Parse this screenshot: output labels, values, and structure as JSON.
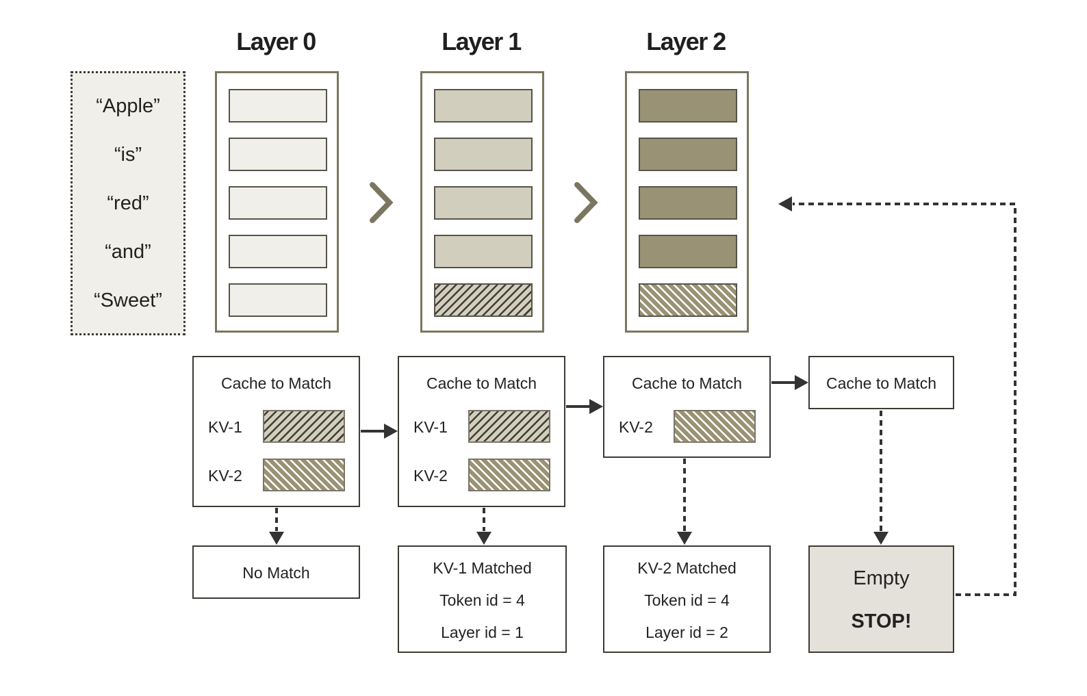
{
  "layers": [
    {
      "title": "Layer 0",
      "slots": [
        "plain",
        "plain",
        "plain",
        "plain",
        "plain"
      ]
    },
    {
      "title": "Layer 1",
      "slots": [
        "filled",
        "filled",
        "filled",
        "filled",
        "kv1-hatched"
      ]
    },
    {
      "title": "Layer 2",
      "slots": [
        "filled",
        "filled",
        "filled",
        "filled",
        "kv2-hatched"
      ]
    }
  ],
  "tokens": [
    "“Apple”",
    "“is”",
    "“red”",
    "“and”",
    "“Sweet”"
  ],
  "cache_boxes": [
    {
      "title": "Cache to Match",
      "entries": [
        {
          "label": "KV-1",
          "pattern": "kv1-hatched"
        },
        {
          "label": "KV-2",
          "pattern": "kv2-hatched"
        }
      ]
    },
    {
      "title": "Cache to Match",
      "entries": [
        {
          "label": "KV-1",
          "pattern": "kv1-hatched"
        },
        {
          "label": "KV-2",
          "pattern": "kv2-hatched"
        }
      ]
    },
    {
      "title": "Cache to Match",
      "entries": [
        {
          "label": "KV-2",
          "pattern": "kv2-hatched"
        }
      ]
    },
    {
      "title": "Cache to Match",
      "entries": []
    }
  ],
  "results": [
    {
      "lines": [
        "No Match"
      ]
    },
    {
      "lines": [
        "KV-1 Matched",
        "Token id = 4",
        "Layer id = 1"
      ]
    },
    {
      "lines": [
        "KV-2 Matched",
        "Token id = 4",
        "Layer id = 2"
      ]
    },
    {
      "lines": [
        "Empty",
        "STOP!"
      ]
    }
  ],
  "icons": {
    "layer_transition": "chevron-right-icon",
    "flow_arrow": "arrow-right-icon",
    "result_arrow": "dashed-arrow-down-icon",
    "loop_back_arrow": "dashed-arrow-left-icon"
  },
  "colors": {
    "layer_border": "#7b765f",
    "layer0_fill": "#f1efe9",
    "layer1_fill": "#d1cebe",
    "layer2_fill": "#9a9275",
    "empty_fill": "#e4e1da",
    "arrow": "#333333"
  }
}
